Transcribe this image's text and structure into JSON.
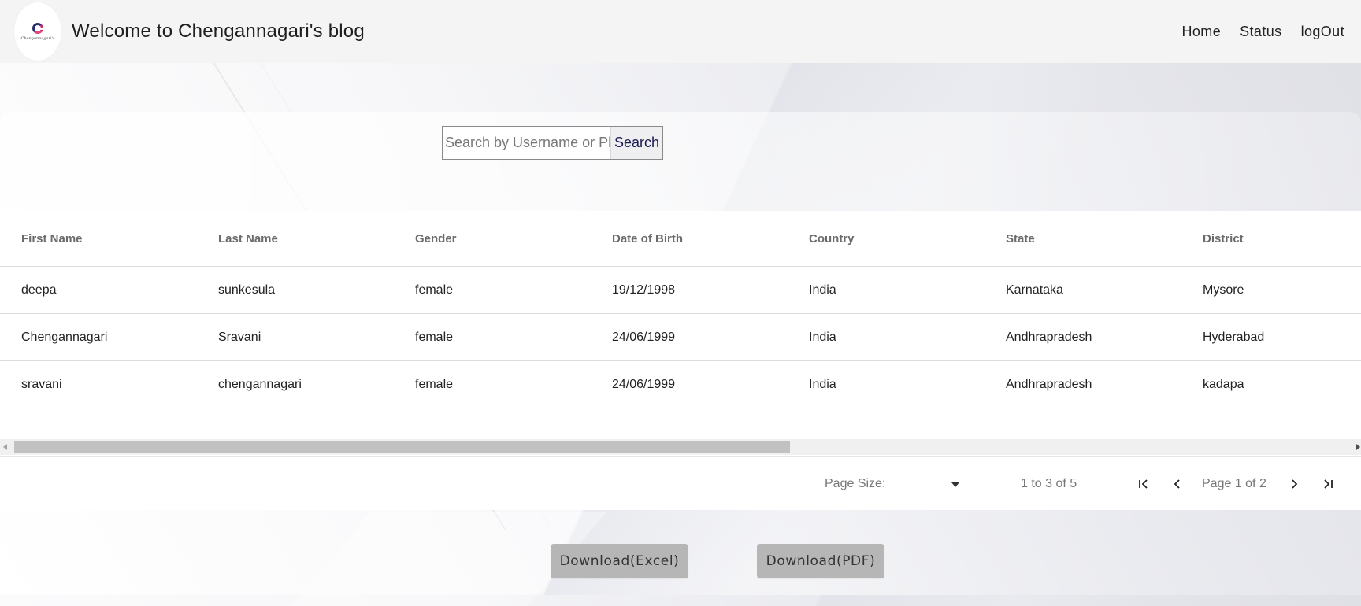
{
  "header": {
    "logo_text": "Chengannagari's",
    "title": "Welcome to Chengannagari's blog",
    "nav": [
      {
        "label": "Home"
      },
      {
        "label": "Status"
      },
      {
        "label": "logOut"
      }
    ]
  },
  "search": {
    "placeholder": "Search by Username or Phone",
    "value": "",
    "button_label": "Search"
  },
  "table": {
    "columns": [
      "First Name",
      "Last Name",
      "Gender",
      "Date of Birth",
      "Country",
      "State",
      "District"
    ],
    "rows": [
      [
        "deepa",
        "sunkesula",
        "female",
        "19/12/1998",
        "India",
        "Karnataka",
        "Mysore"
      ],
      [
        "Chengannagari",
        "Sravani",
        "female",
        "24/06/1999",
        "India",
        "Andhrapradesh",
        "Hyderabad"
      ],
      [
        "sravani",
        "chengannagari",
        "female",
        "24/06/1999",
        "India",
        "Andhrapradesh",
        "kadapa"
      ]
    ]
  },
  "pagination": {
    "page_size_label": "Page Size:",
    "page_size_value": "",
    "row_summary": "1 to 3 of 5",
    "page_status": "Page 1 of 2",
    "icons": [
      "first-page-icon",
      "previous-page-icon",
      "next-page-icon",
      "last-page-icon"
    ]
  },
  "downloads": {
    "excel_label": "Download(Excel)",
    "pdf_label": "Download(PDF)"
  },
  "colors": {
    "header_bg": "#f4f4f4",
    "button_bg": "#b6b6b6",
    "search_button_text": "#1b1b50"
  }
}
